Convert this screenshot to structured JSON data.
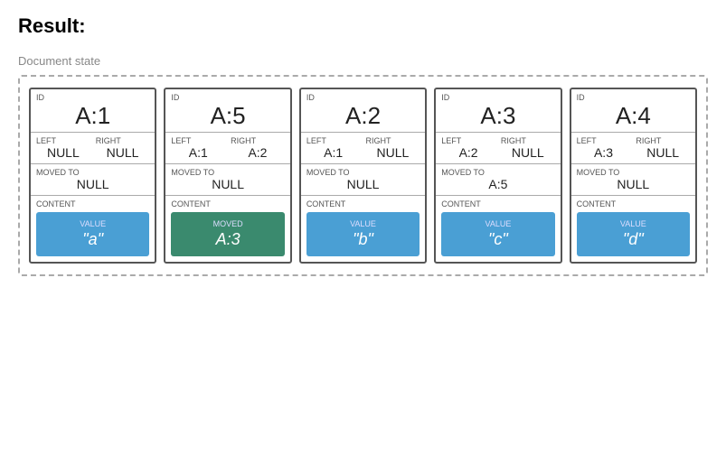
{
  "title": "Result:",
  "section_label": "Document state",
  "nodes": [
    {
      "id": "A:1",
      "left": "NULL",
      "right": "NULL",
      "moved_to": "NULL",
      "content_label": "CONTENT",
      "content_type": "value",
      "content_value": "\"a\""
    },
    {
      "id": "A:5",
      "left": "A:1",
      "right": "A:2",
      "moved_to": "NULL",
      "content_label": "CONTENT",
      "content_type": "moved",
      "content_value": "A:3"
    },
    {
      "id": "A:2",
      "left": "A:1",
      "right": "NULL",
      "moved_to": "NULL",
      "content_label": "CONTENT",
      "content_type": "value",
      "content_value": "\"b\""
    },
    {
      "id": "A:3",
      "left": "A:2",
      "right": "NULL",
      "moved_to": "A:5",
      "content_label": "CONTENT",
      "content_type": "value",
      "content_value": "\"c\""
    },
    {
      "id": "A:4",
      "left": "A:3",
      "right": "NULL",
      "moved_to": "NULL",
      "content_label": "CONTENT",
      "content_type": "value",
      "content_value": "\"d\""
    }
  ],
  "labels": {
    "id": "ID",
    "left": "LEFT",
    "right": "RIGHT",
    "moved_to": "MOVED TO",
    "value": "VALUE",
    "moved": "MOVED"
  }
}
